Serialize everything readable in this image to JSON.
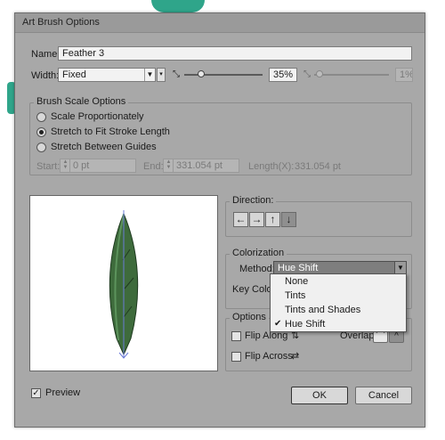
{
  "window": {
    "title": "Art Brush Options"
  },
  "name": {
    "label": "Name:",
    "value": "Feather 3"
  },
  "width": {
    "label": "Width:",
    "selected": "Fixed",
    "percent": "35%",
    "secondary_percent": "1%"
  },
  "brush_scale": {
    "title": "Brush Scale Options",
    "options": [
      "Scale Proportionately",
      "Stretch to Fit Stroke Length",
      "Stretch Between Guides"
    ],
    "selected_index": 1,
    "start_label": "Start:",
    "start_value": "0 pt",
    "end_label": "End:",
    "end_value": "331.054 pt",
    "length_label": "Length(X):",
    "length_value": "331.054 pt"
  },
  "direction": {
    "title": "Direction:",
    "arrows": [
      "←",
      "→",
      "↑",
      "↓"
    ],
    "selected_index": 3
  },
  "colorization": {
    "title": "Colorization",
    "method_label": "Method:",
    "method_value": "Hue Shift",
    "key_color_label": "Key Color:",
    "menu_items": [
      "None",
      "Tints",
      "Tints and Shades",
      "Hue Shift"
    ],
    "checked_index": 3
  },
  "options": {
    "title": "Options",
    "flip_along": "Flip Along",
    "flip_across": "Flip Across",
    "overlap_label": "Overlap:"
  },
  "preview": {
    "label": "Preview",
    "checked": true
  },
  "buttons": {
    "ok": "OK",
    "cancel": "Cancel"
  },
  "colors": {
    "accent_teal": "#2fa58a",
    "feather_fill": "#3e6b3c",
    "dialog_bg": "#a8a8a8"
  }
}
